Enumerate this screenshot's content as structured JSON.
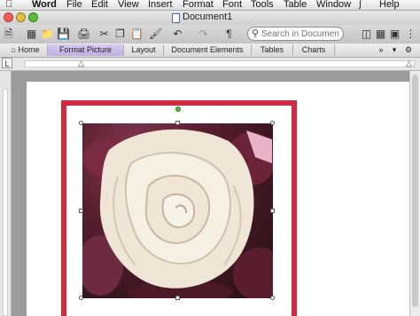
{
  "menubar": {
    "apple_icon": "apple-icon",
    "items": [
      "Word",
      "File",
      "Edit",
      "View",
      "Insert",
      "Format",
      "Font",
      "Tools",
      "Table",
      "Window",
      "Help"
    ],
    "script_icon": "script-icon"
  },
  "window": {
    "title": "Document1",
    "lights": {
      "close": "#fc5b57",
      "minimize": "#e5bf3c",
      "zoom": "#57c038"
    }
  },
  "toolbar": {
    "search_placeholder": "Search in Document",
    "pilcrow": "¶"
  },
  "ribbon": {
    "tabs": [
      "Home",
      "Format Picture",
      "Layout",
      "Document Elements",
      "Tables",
      "Charts"
    ],
    "active_tab": "Format Picture",
    "more": "»"
  },
  "colors": {
    "frame_border": "#d6283e",
    "active_tab": "#c7b8e9",
    "rotate_handle": "#5fbf3a"
  },
  "image": {
    "subject": "white fabric rose on dark red petals"
  }
}
